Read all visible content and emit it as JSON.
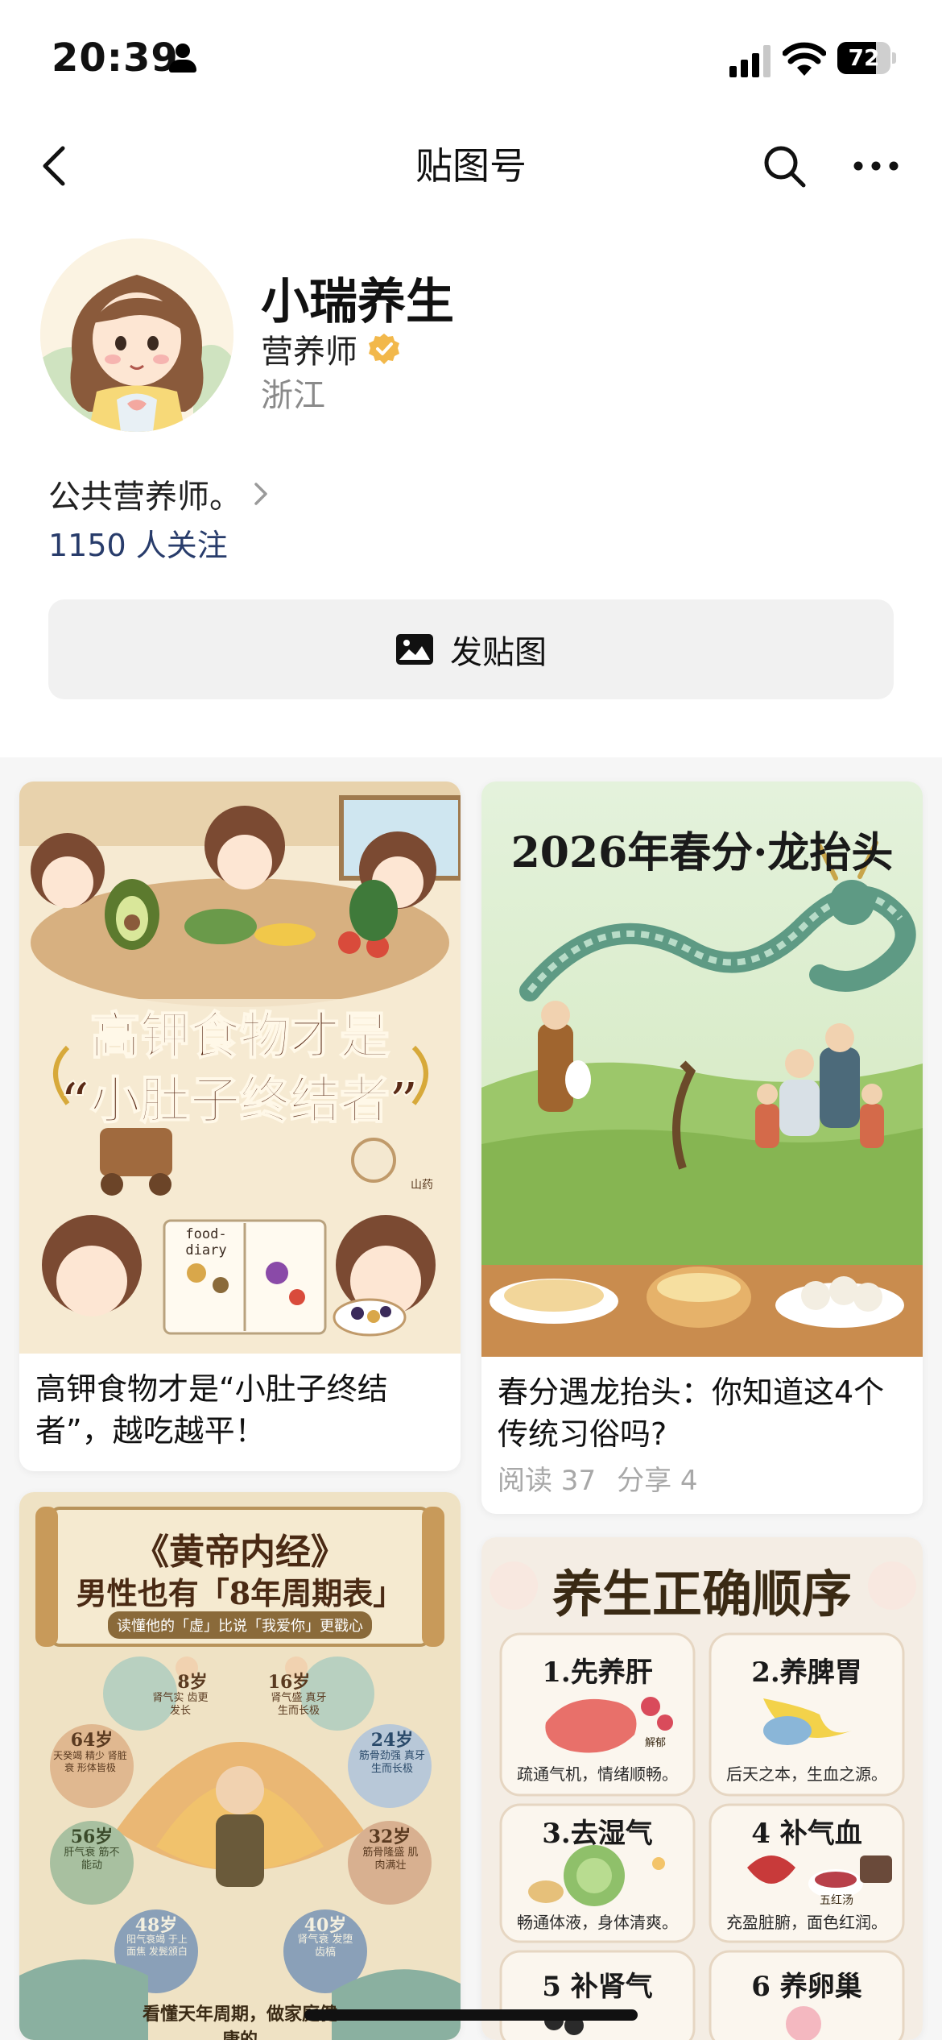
{
  "status_bar": {
    "time": "20:39",
    "battery": "72",
    "battery_level": 0.72
  },
  "nav": {
    "title": "贴图号",
    "back_icon": "chevron-left-icon",
    "search_icon": "search-icon",
    "more_icon": "more-horizontal-icon"
  },
  "profile": {
    "name": "小瑞养生",
    "role": "营养师",
    "region": "浙江",
    "bio": "公共营养师。",
    "followers": "1150 人关注",
    "verified_color": "#f2b84b"
  },
  "actions": {
    "post_label": "发贴图"
  },
  "feed": {
    "cards": [
      {
        "art_title_line1": "高钾食物才是",
        "art_title_line2": "“小肚子终结者”",
        "art_small_label": "山药",
        "art_book_label": "food-diary",
        "caption": "高钾食物才是“小肚子终结者”，越吃越平！"
      },
      {
        "art_title": "2026年春分·龙抬头",
        "caption": "春分遇龙抬头：你知道这4个传统习俗吗?",
        "reads": "阅读 37",
        "shares": "分享 4"
      },
      {
        "art_title_line1": "《黄帝内经》",
        "art_title_line2": "男性也有「8年周期表」",
        "art_subtitle": "读懂他的「虚」比说「我爱你」更戳心",
        "ages": [
          "8岁",
          "16岁",
          "24岁",
          "32岁",
          "40岁",
          "48岁",
          "56岁",
          "64岁"
        ],
        "age_notes": [
          "肾气实 齿更发长",
          "肾气盛 真牙生而长极",
          "筋骨劲强 真牙生而长极",
          "筋骨隆盛 肌肉满壮",
          "肾气衰 发堕齿槁",
          "阳气衰竭 于上 面焦 发鬓颁白",
          "肝气衰 筋不能动",
          "天癸竭 精少 肾脏衰 形体皆极"
        ],
        "art_footer": "看懂天年周期，做家庭健康的"
      },
      {
        "art_title": "养生正确顺序",
        "items": [
          {
            "title": "1.先养肝",
            "desc": "疏通气机，情绪顺畅。"
          },
          {
            "title": "2.养脾胃",
            "desc": "后天之本，生血之源。"
          },
          {
            "title": "3.去湿气",
            "desc": "畅通体液，身体清爽。"
          },
          {
            "title": "4 补气血",
            "desc": "充盈脏腑，面色红润。"
          },
          {
            "title": "5 补肾气",
            "desc": ""
          },
          {
            "title": "6 养卵巢",
            "desc": ""
          }
        ],
        "liver_tag": "解郁",
        "soup_tag": "五红汤"
      }
    ]
  }
}
